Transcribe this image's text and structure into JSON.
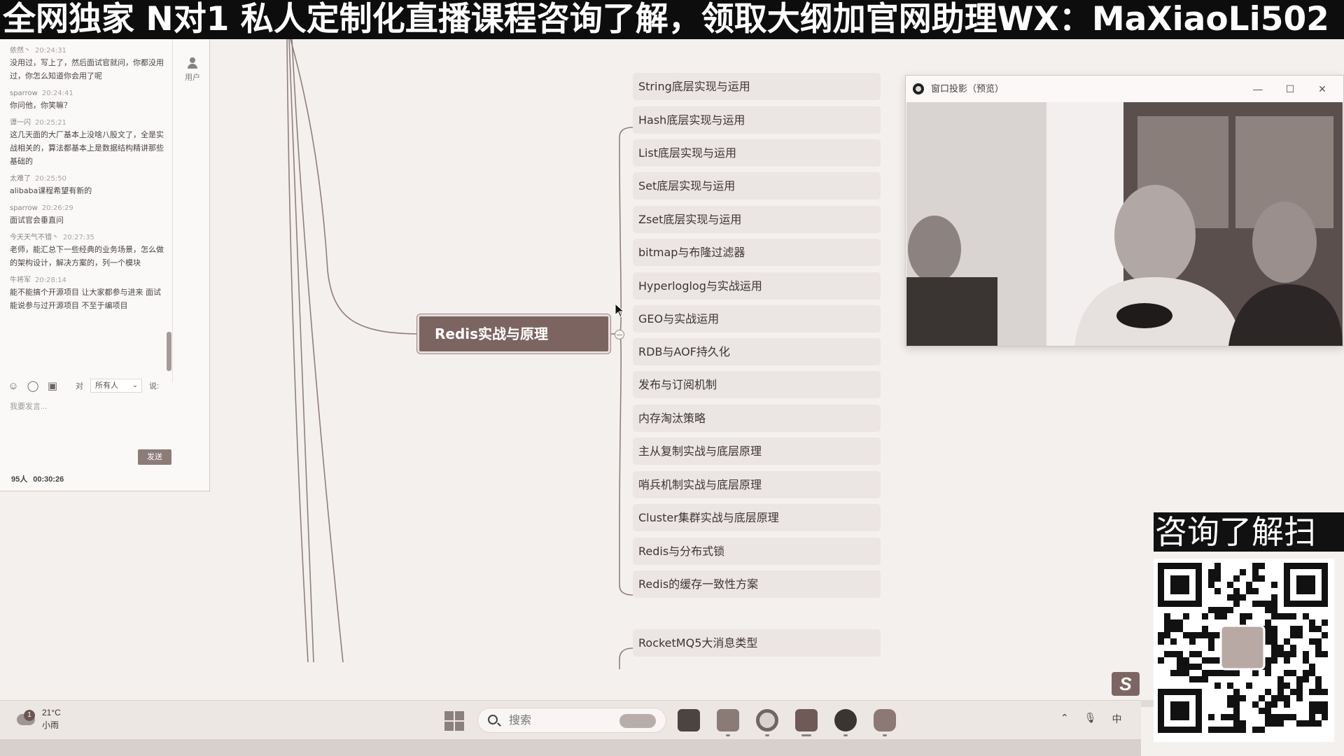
{
  "banner": {
    "text": "全网独家 N对1 私人定制化直播课程咨询了解，领取大纲加官网助理WX：MaXiaoLi502"
  },
  "chat": {
    "messages": [
      {
        "user": "依然丶",
        "time": "20:24:31",
        "text": "没用过，写上了，然后面试官就问，你都没用过，你怎么知道你会用了呢"
      },
      {
        "user": "sparrow",
        "time": "20:24:41",
        "text": "你问他，你笑嘛？"
      },
      {
        "user": "谭一闪",
        "time": "20:25:21",
        "text": "这几天面的大厂基本上没啥八股文了，全是实战相关的，算法都基本上是数据结构精讲那些基础的"
      },
      {
        "user": "太难了",
        "time": "20:25:50",
        "text": "alibaba课程希望有新的"
      },
      {
        "user": "sparrow",
        "time": "20:26:29",
        "text": "面试官会垂直问"
      },
      {
        "user": "今天天气不错丶",
        "time": "20:27:35",
        "text": "老师，能汇总下一些经典的业务场景，怎么做的架构设计，解决方案的，列一个模块"
      },
      {
        "user": "牛将军",
        "time": "20:28:14",
        "text": "能不能搞个开源项目 让大家都参与进来 面试能说参与过开源项目 不至于编项目"
      }
    ],
    "sidebar_user_label": "用户",
    "to_label": "对",
    "recipient": "所有人",
    "say_label": "说:",
    "input_placeholder": "我要发言...",
    "send_label": "发送",
    "count": "95人",
    "elapsed": "00:30:26"
  },
  "mindmap": {
    "root": "Redis实战与原理",
    "children": [
      "String底层实现与运用",
      "Hash底层实现与运用",
      "List底层实现与运用",
      "Set底层实现与运用",
      "Zset底层实现与运用",
      "bitmap与布隆过滤器",
      "Hyperloglog与实战运用",
      "GEO与实战运用",
      "RDB与AOF持久化",
      "发布与订阅机制",
      "内存淘汰策略",
      "主从复制实战与底层原理",
      "哨兵机制实战与底层原理",
      "Cluster集群实战与底层原理",
      "Redis与分布式锁",
      "Redis的缓存一致性方案"
    ],
    "next_branch": "RocketMQ5大消息类型"
  },
  "preview": {
    "title": "窗口投影（预览）"
  },
  "taskbar": {
    "weather_temp": "21°C",
    "weather_desc": "小雨",
    "weather_badge": "1",
    "search_placeholder": "搜索",
    "ime": "中"
  },
  "ad": {
    "title": "咨询了解扫"
  },
  "colors": {
    "accent": "#7c6461",
    "node_bg": "#ebe5e3",
    "banner_bg": "#0d0d0d"
  }
}
